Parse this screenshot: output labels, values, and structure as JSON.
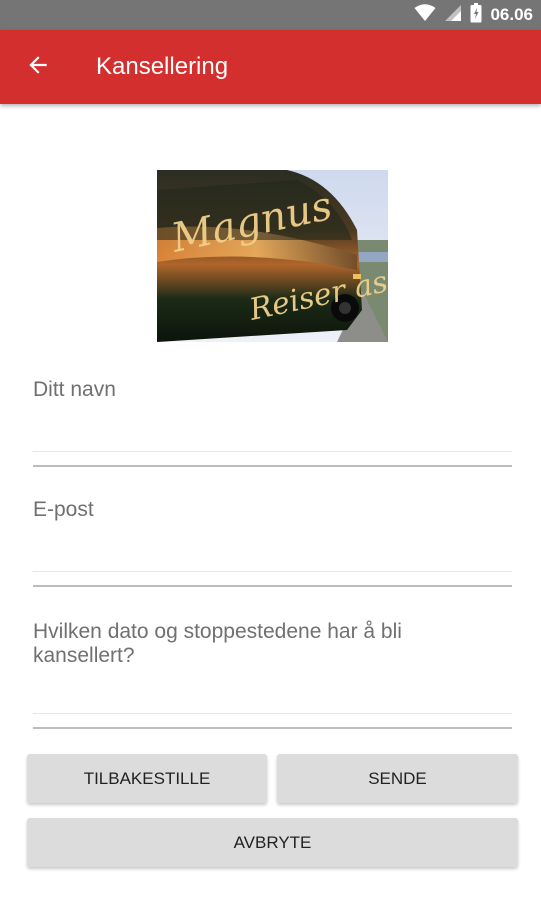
{
  "status_bar": {
    "time": "06.06",
    "icons": [
      "wifi-icon",
      "cell-signal-icon",
      "battery-icon"
    ]
  },
  "app_bar": {
    "title": "Kansellering",
    "back_icon": "arrow-left-icon",
    "color": "#d32f2f"
  },
  "logo": {
    "text": "Magnus Reiser as"
  },
  "form": {
    "name_label": "Ditt navn",
    "name_value": "",
    "email_label": "E-post",
    "email_value": "",
    "stops_label": "Hvilken dato og stoppestedene har å bli kansellert?",
    "stops_value": ""
  },
  "buttons": {
    "reset_label": "TILBAKESTILLE",
    "send_label": "SENDE",
    "cancel_label": "AVBRYTE"
  }
}
